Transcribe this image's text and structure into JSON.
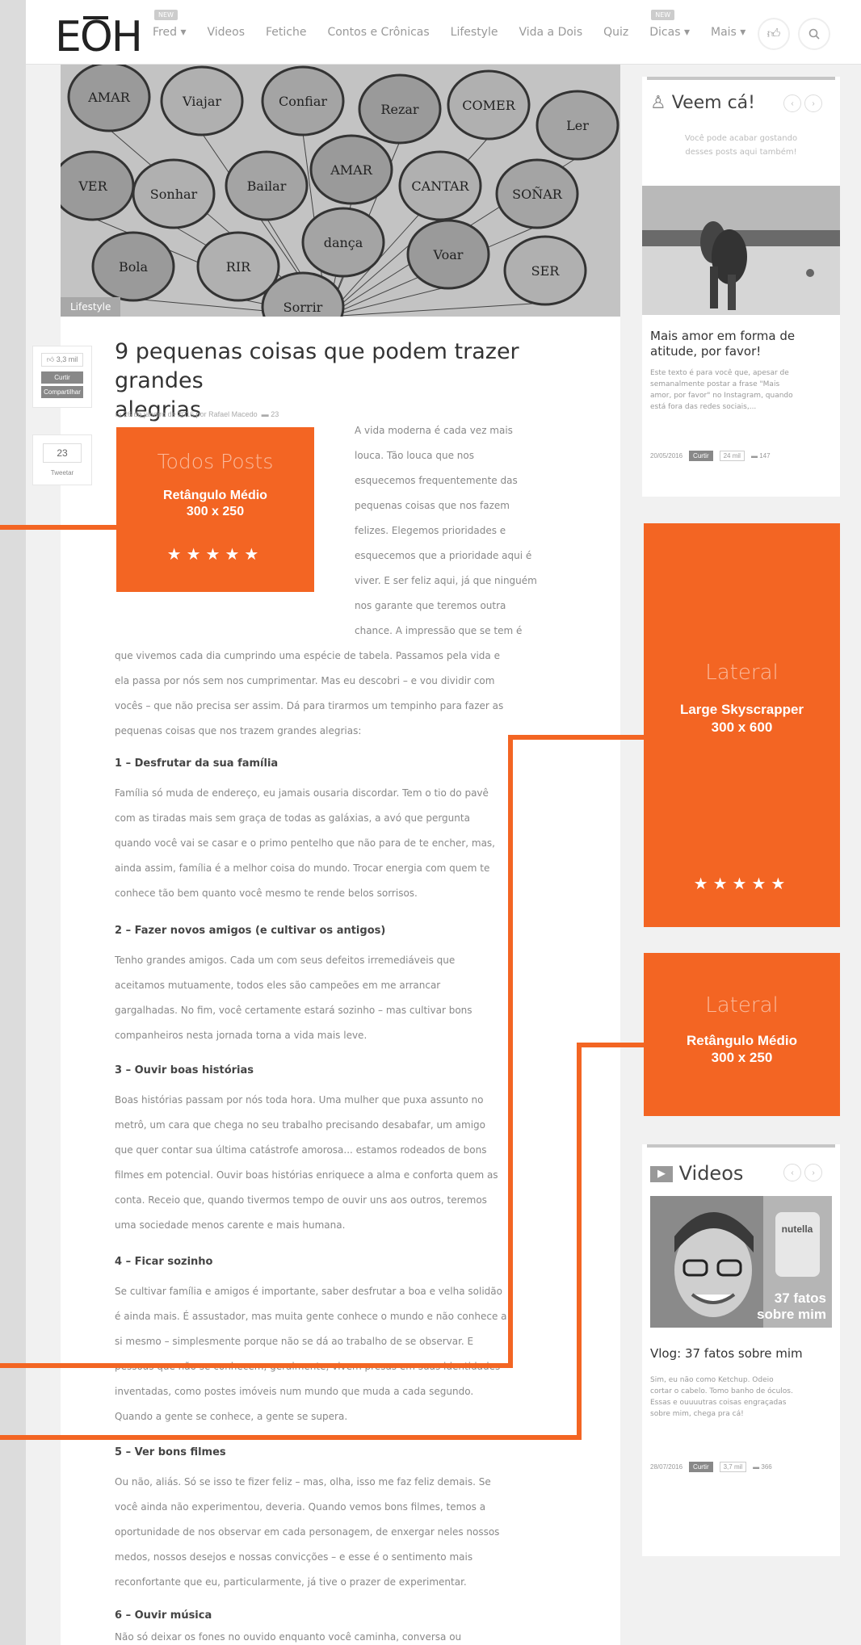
{
  "logo": "EOH",
  "nav": {
    "items": [
      {
        "label": "Fred",
        "caret": "▾",
        "badge": "NEW"
      },
      {
        "label": "Videos"
      },
      {
        "label": "Fetiche"
      },
      {
        "label": "Contos e Crônicas"
      },
      {
        "label": "Lifestyle"
      },
      {
        "label": "Vida a Dois"
      },
      {
        "label": "Quiz"
      },
      {
        "label": "Dicas",
        "caret": "▾",
        "badge": "NEW"
      },
      {
        "label": "Mais",
        "caret": "▾"
      }
    ],
    "like_icon": "thumbs-up-icon",
    "search_icon": "search-icon"
  },
  "hero": {
    "category": "Lifestyle",
    "balloon_words": [
      "AMAR",
      "Viajar",
      "Confiar",
      "Rezar",
      "COMER",
      "Ler",
      "VER",
      "Sonhar",
      "Bailar",
      "AMAR",
      "CANTAR",
      "SOÑAR",
      "Bola",
      "RIR",
      "dança",
      "Voar",
      "SER",
      "Sorrir"
    ]
  },
  "share": {
    "likes": "3,3 mil",
    "curtir": "Curtir",
    "compartilhar": "Compartilhar",
    "count": "23",
    "tweet": "Tweetar"
  },
  "article": {
    "title_line1": "9 pequenas coisas que podem trazer grandes",
    "title_line2": "alegrias",
    "meta": "26 de janeiro de 2016 por Rafael Macedo",
    "comments": "23",
    "intro_lines": [
      "A vida moderna é cada vez mais",
      "louca. Tão louca que nos",
      "esquecemos frequentemente das",
      "pequenas coisas que nos fazem",
      "felizes. Elegemos prioridades e",
      "esquecemos que a prioridade aqui é",
      "viver. E ser feliz aqui, já que ninguém",
      "nos garante que teremos outra",
      "chance. A impressão que se tem é"
    ],
    "intro_cont": [
      "que vivemos cada dia cumprindo uma espécie de tabela. Passamos pela vida e",
      "ela passa por nós sem nos cumprimentar. Mas eu descobri – e vou dividir com",
      "vocês – que não precisa ser assim. Dá para tirarmos um tempinho para fazer as",
      "pequenas coisas que nos trazem grandes alegrias:"
    ],
    "sections": [
      {
        "heading": "1 – Desfrutar da sua família",
        "lines": [
          "Família só muda de endereço, eu jamais ousaria discordar. Tem o tio do pavê",
          "com as tiradas mais sem graça de todas as galáxias, a avó que pergunta",
          "quando você vai se casar e o primo pentelho que não para de te encher, mas,",
          "ainda assim, família é a melhor coisa do mundo. Trocar energia com quem te",
          "conhece tão bem quanto você mesmo te rende belos sorrisos."
        ]
      },
      {
        "heading": "2 – Fazer novos amigos (e cultivar os antigos)",
        "lines": [
          "Tenho grandes amigos. Cada um com seus defeitos irremediáveis que",
          "aceitamos mutuamente, todos eles são campeões em me arrancar",
          "gargalhadas. No fim, você certamente estará sozinho – mas cultivar bons",
          "companheiros nesta jornada torna a vida mais leve."
        ]
      },
      {
        "heading": "3 – Ouvir boas histórias",
        "lines": [
          "Boas histórias passam por nós toda hora. Uma mulher que puxa assunto no",
          "metrô, um cara que chega no seu trabalho precisando desabafar, um amigo",
          "que quer contar sua última catástrofe amorosa... estamos rodeados de bons",
          "filmes em potencial. Ouvir boas histórias enriquece a alma e conforta quem as",
          "conta. Receio que, quando tivermos tempo de ouvir uns aos outros, teremos",
          "uma sociedade menos carente e mais humana."
        ]
      },
      {
        "heading": "4 – Ficar sozinho",
        "lines": [
          "Se cultivar família e amigos é importante, saber desfrutar a boa e velha solidão",
          "é ainda mais. É assustador, mas muita gente conhece o mundo e não conhece a",
          "si mesmo – simplesmente porque não se dá ao trabalho de se observar. E",
          "pessoas que não se conhecem, geralmente, vivem presas em suas identidades",
          "inventadas, como postes imóveis num mundo que muda a cada segundo.",
          "Quando a gente se conhece, a gente se supera."
        ]
      },
      {
        "heading": "5 – Ver bons filmes",
        "lines": [
          "Ou não, aliás. Só se isso te fizer feliz – mas, olha, isso me faz feliz demais. Se",
          "você ainda não experimentou, deveria. Quando vemos bons filmes, temos a",
          "oportunidade de nos observar em cada personagem, de enxergar neles nossos",
          "medos, nossos desejos e nossas convicções – e esse é o sentimento mais",
          "reconfortante que eu, particularmente, já tive o prazer de experimentar."
        ]
      },
      {
        "heading": "6 – Ouvir música",
        "lines": [
          "Não só deixar os fones no ouvido enquanto você caminha, conversa ou"
        ]
      }
    ]
  },
  "ads": {
    "post": {
      "heading": "Todos Posts",
      "name": "Retângulo Médio",
      "size": "300 x 250",
      "stars": "★★★★★"
    },
    "skyscraper": {
      "heading": "Lateral",
      "name": "Large Skyscrapper",
      "size": "300 x 600",
      "stars": "★★★★★"
    },
    "side_rect": {
      "heading": "Lateral",
      "name": "Retângulo Médio",
      "size": "300 x 250"
    }
  },
  "widget_veem": {
    "title": "Veem cá!",
    "subtitle_line1": "Você pode acabar gostando",
    "subtitle_line2": "desses posts aqui também!",
    "post_title_line1": "Mais amor em forma de",
    "post_title_line2": "atitude, por favor!",
    "excerpt": [
      "Este texto é para você que, apesar de",
      "semanalmente postar a frase \"Mais",
      "amor, por favor\" no Instagram, quando",
      "está fora das redes sociais,..."
    ],
    "date": "20/05/2016",
    "curtir": "Curtir",
    "likes": "24 mil",
    "comments": "147"
  },
  "widget_videos": {
    "title": "Videos",
    "thumb_caption_line1": "37 fatos",
    "thumb_caption_line2": "sobre mim",
    "jar_label": "nutella",
    "post_title": "Vlog: 37 fatos sobre mim",
    "excerpt": [
      "Sim, eu não como Ketchup. Odeio",
      "cortar o cabelo. Tomo banho de óculos.",
      "Essas e ouuuutras coisas engraçadas",
      "sobre mim, chega pra cá!"
    ],
    "date": "28/07/2016",
    "curtir": "Curtir",
    "likes": "3,7 mil",
    "comments": "366"
  },
  "colors": {
    "accent": "#f36523",
    "page_bg": "#f1f1f1",
    "text": "#888888"
  }
}
